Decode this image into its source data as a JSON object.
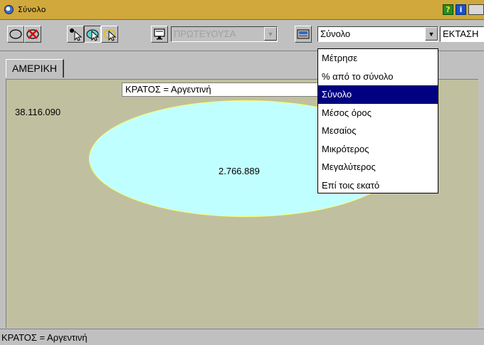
{
  "window": {
    "title": "Σύνολο",
    "buttons": {
      "help": "?",
      "info": "i"
    }
  },
  "toolbar": {
    "field_combo": {
      "value": "ΠΡΩΤΕΥΟΥΣΑ",
      "disabled": true
    },
    "aggregate_combo": {
      "value": "Σύνολο"
    },
    "second_field_combo": {
      "value": "ΕΚΤΑΣΗ"
    }
  },
  "tabs": [
    {
      "label": "ΑΜΕΡΙΚΗ",
      "active": true
    }
  ],
  "canvas": {
    "filter_label": "ΚΡΑΤΟΣ = Αργεντινή",
    "total_value": "38.116.090",
    "ellipse_value": "2.766.889",
    "colors": {
      "background": "#c0c0a0",
      "ellipse_fill": "#c0ffff",
      "ellipse_border": "#ffff60"
    }
  },
  "dropdown": {
    "options": [
      "Μέτρησε",
      "% από το σύνολο",
      "Σύνολο",
      "Μέσος όρος",
      "Μεσαίος",
      "Μικρότερος",
      "Μεγαλύτερος",
      "Επί τοις εκατό"
    ],
    "selected_index": 2
  },
  "statusbar": {
    "text": "ΚΡΑΤΟΣ = Αργεντινή"
  }
}
